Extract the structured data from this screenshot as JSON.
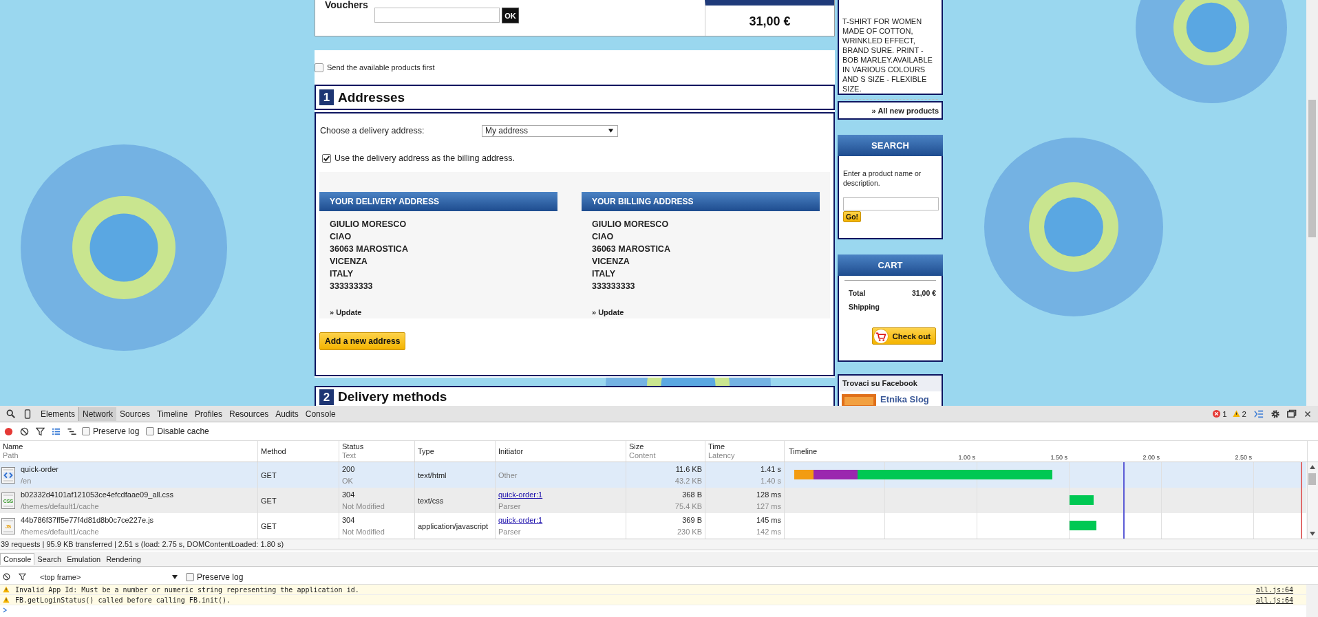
{
  "page": {
    "vouchers": {
      "label": "Vouchers",
      "button": "OK",
      "total": "31,00 €"
    },
    "available_first": {
      "label": "Send the available products first",
      "checked": false
    },
    "addresses": {
      "number": "1",
      "title": "Addresses",
      "choose_label": "Choose a delivery address:",
      "choose_value": "My address",
      "same_billing": {
        "label": "Use the delivery address as the billing address.",
        "checked": true
      },
      "cards": [
        {
          "title": "YOUR DELIVERY ADDRESS",
          "lines": [
            "GIULIO MORESCO",
            "CIAO",
            "36063 MAROSTICA",
            "VICENZA",
            "ITALY",
            "333333333"
          ],
          "update": "» Update"
        },
        {
          "title": "YOUR BILLING ADDRESS",
          "lines": [
            "GIULIO MORESCO",
            "CIAO",
            "36063 MAROSTICA",
            "VICENZA",
            "ITALY",
            "333333333"
          ],
          "update": "» Update"
        }
      ],
      "add_button": "Add a new address"
    },
    "delivery": {
      "number": "2",
      "title": "Delivery methods"
    }
  },
  "sidebar": {
    "product_text": "T-SHIRT FOR WOMEN MADE OF COTTON, WRINKLED EFFECT, BRAND SURE. PRINT - BOB MARLEY.AVAILABLE IN VARIOUS COLOURS AND S SIZE - FLEXIBLE SIZE.",
    "all_new": "» All new products",
    "search": {
      "title": "SEARCH",
      "hint": "Enter a product name or description.",
      "button": "Go!"
    },
    "cart": {
      "title": "CART",
      "rows": [
        {
          "label": "Total",
          "value": "31,00 €"
        },
        {
          "label": "Shipping"
        }
      ],
      "checkout": "Check out"
    },
    "facebook": {
      "title": "Trovaci su Facebook",
      "page": "Etnika Slog"
    }
  },
  "devtools": {
    "tabs": [
      {
        "label": "Elements",
        "selected": false
      },
      {
        "label": "Network",
        "selected": true
      },
      {
        "label": "Sources",
        "selected": false
      },
      {
        "label": "Timeline",
        "selected": false
      },
      {
        "label": "Profiles",
        "selected": false
      },
      {
        "label": "Resources",
        "selected": false
      },
      {
        "label": "Audits",
        "selected": false
      },
      {
        "label": "Console",
        "selected": false
      }
    ],
    "errors": "1",
    "warnings": "2",
    "recording": true,
    "large_rows": true,
    "preserve_log": {
      "label": "Preserve log",
      "checked": false
    },
    "disable_cache": {
      "label": "Disable cache",
      "checked": false
    },
    "columns": [
      {
        "title": "Name",
        "subtitle": "Path"
      },
      {
        "title": "Method"
      },
      {
        "title": "Status",
        "subtitle": "Text"
      },
      {
        "title": "Type"
      },
      {
        "title": "Initiator"
      },
      {
        "title": "Size",
        "subtitle": "Content"
      },
      {
        "title": "Time",
        "subtitle": "Latency"
      },
      {
        "title": "Timeline"
      }
    ],
    "ticks": [
      "1.00 s",
      "1.50 s",
      "2.00 s",
      "2.50 s"
    ],
    "rows": [
      {
        "kind": "html",
        "name": "quick-order",
        "path": "/en",
        "method": "GET",
        "status": "200",
        "status_text": "OK",
        "type": "text/html",
        "initiator": {
          "kind": "text",
          "text": "Other"
        },
        "size": "11.6 KB",
        "content": "43.2 KB",
        "time": "1.41 s",
        "latency": "1.40 s",
        "selected": true
      },
      {
        "kind": "css",
        "icon_label": "CSS",
        "name": "b02332d4101af121053ce4efcdfaae09_all.css",
        "path": "/themes/default1/cache",
        "method": "GET",
        "status": "304",
        "status_text": "Not Modified",
        "type": "text/css",
        "initiator": {
          "kind": "link",
          "text": "quick-order:1",
          "detail": "Parser"
        },
        "size": "368 B",
        "content": "75.4 KB",
        "time": "128 ms",
        "latency": "127 ms",
        "selected": false
      },
      {
        "kind": "js",
        "icon_label": "JS",
        "name": "44b786f37ff5e77f4d81d8b0c7ce227e.js",
        "path": "/themes/default1/cache",
        "method": "GET",
        "status": "304",
        "status_text": "Not Modified",
        "type": "application/javascript",
        "initiator": {
          "kind": "link",
          "text": "quick-order:1",
          "detail": "Parser"
        },
        "size": "369 B",
        "content": "230 KB",
        "time": "145 ms",
        "latency": "142 ms",
        "selected": false
      }
    ],
    "summary": "39 requests | 95.9 KB transferred | 2.51 s (load: 2.75 s, DOMContentLoaded: 1.80 s)",
    "drawer_tabs": [
      {
        "label": "Console",
        "selected": true
      },
      {
        "label": "Search",
        "selected": false
      },
      {
        "label": "Emulation",
        "selected": false
      },
      {
        "label": "Rendering",
        "selected": false
      }
    ],
    "context": "<top frame>",
    "console_preserve": {
      "label": "Preserve log",
      "checked": false
    },
    "messages": [
      {
        "kind": "warning",
        "text": "Invalid App Id: Must be a number or numeric string representing the application id.",
        "source": "all.js:64"
      },
      {
        "kind": "warning",
        "text": "FB.getLoginStatus() called before calling FB.init().",
        "source": "all.js:64"
      }
    ]
  }
}
